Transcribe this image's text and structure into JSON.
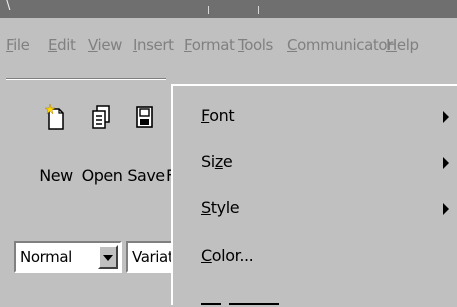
{
  "title_glyph": "\\",
  "menubar": {
    "items": [
      {
        "label": "File",
        "first": "F",
        "rest": "ile"
      },
      {
        "label": "Edit",
        "first": "E",
        "rest": "dit"
      },
      {
        "label": "View",
        "first": "V",
        "rest": "iew"
      },
      {
        "label": "Insert",
        "first": "I",
        "rest": "nsert"
      },
      {
        "label": "Format",
        "first": "F",
        "rest": "ormat"
      },
      {
        "label": "Tools",
        "first": "T",
        "rest": "ools"
      },
      {
        "label": "Communicator",
        "first": "C",
        "rest": "ommunicator"
      },
      {
        "label": "Help",
        "first": "H",
        "rest": "elp"
      }
    ]
  },
  "toolbar": {
    "new_label": "New",
    "open_label": "Open",
    "save_label": "Save",
    "partial_label": "F"
  },
  "format_bar": {
    "style_value": "Normal",
    "font_value": "Variat"
  },
  "format_menu": {
    "font": {
      "pre": "",
      "u": "F",
      "post": "ont"
    },
    "size": {
      "pre": "Si",
      "u": "z",
      "post": "e"
    },
    "style": {
      "pre": "",
      "u": "S",
      "post": "tyle"
    },
    "color": {
      "pre": "",
      "u": "C",
      "post": "olor..."
    }
  }
}
